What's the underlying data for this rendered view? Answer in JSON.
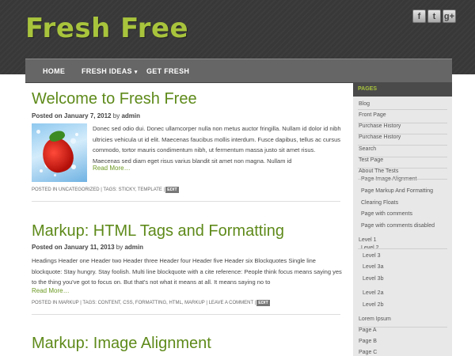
{
  "site": {
    "title": "Fresh Free"
  },
  "social": [
    "f",
    "t",
    "g+"
  ],
  "nav": [
    {
      "label": "HOME"
    },
    {
      "label": "FRESH IDEAS",
      "caret": "▾"
    },
    {
      "label": "GET FRESH"
    }
  ],
  "posts": [
    {
      "title": "Welcome to Fresh Free",
      "meta_prefix": "Posted on",
      "date": "January 7, 2012",
      "by": "by",
      "author": "admin",
      "excerpt": "Donec sed odio dui. Donec ullamcorper nulla non metus auctor fringilla. Nullam id dolor id nibh ultricies vehicula ut id elit. Maecenas faucibus mollis interdum. Fusce dapibus, tellus ac cursus commodo, tortor mauris condimentum nibh, ut fermentum massa justo sit amet risus. Maecenas sed diam eget risus varius blandit sit amet non magna. Nullam id",
      "read_more": "Read More…",
      "tags_line": "POSTED IN UNCATEGORIZED | TAGS: STICKY, TEMPLATE |",
      "edit": "EDIT"
    },
    {
      "title": "Markup: HTML Tags and Formatting",
      "meta_prefix": "Posted on",
      "date": "January 11, 2013",
      "by": "by",
      "author": "admin",
      "excerpt": "Headings Header one Header two Header three Header four Header five Header six Blockquotes Single line blockquote: Stay hungry. Stay foolish. Multi line blockquote with a cite reference: People think focus means saying yes to the thing you've got to focus on. But that's not what it means at all. It means saying no to",
      "read_more": "Read More…",
      "tags_line": "POSTED IN MARKUP | TAGS: CONTENT, CSS, FORMATTING, HTML, MARKUP | LEAVE A COMMENT |",
      "edit": "EDIT"
    },
    {
      "title": "Markup: Image Alignment"
    }
  ],
  "sidebar": {
    "heading": "PAGES",
    "items": [
      {
        "label": "Blog",
        "indent": 0
      },
      {
        "label": "Front Page",
        "indent": 0
      },
      {
        "label": "Purchase History",
        "indent": 0
      },
      {
        "label": "Purchase History",
        "indent": 0
      },
      {
        "label": "Search",
        "indent": 0
      },
      {
        "label": "Test Page",
        "indent": 0
      },
      {
        "label": "About The Tests",
        "indent": 0
      },
      {
        "label": "Page Image Alignment",
        "indent": 1
      },
      {
        "label": "Page Markup And Formatting",
        "indent": 1
      },
      {
        "label": "Clearing Floats",
        "indent": 1
      },
      {
        "label": "Page with comments",
        "indent": 1
      },
      {
        "label": "Page with comments disabled",
        "indent": 1
      },
      {
        "label": "Level 1",
        "indent": 0
      },
      {
        "label": "Level 2",
        "indent": 1
      },
      {
        "label": "Level 3",
        "indent": 2
      },
      {
        "label": "Level 3a",
        "indent": 2
      },
      {
        "label": "Level 3b",
        "indent": 2
      },
      {
        "label": "Level 2a",
        "indent": 2
      },
      {
        "label": "Level 2b",
        "indent": 2
      },
      {
        "label": "Lorem Ipsum",
        "indent": 0
      },
      {
        "label": "Page A",
        "indent": 0
      },
      {
        "label": "Page B",
        "indent": 0
      },
      {
        "label": "Page C",
        "indent": 0
      }
    ]
  },
  "colors": {
    "accent": "#a8c43c",
    "link": "#5e8a1a",
    "header_bg": "#383838",
    "nav_bg": "#666666",
    "sidebar_bg": "#e8e8e8"
  }
}
